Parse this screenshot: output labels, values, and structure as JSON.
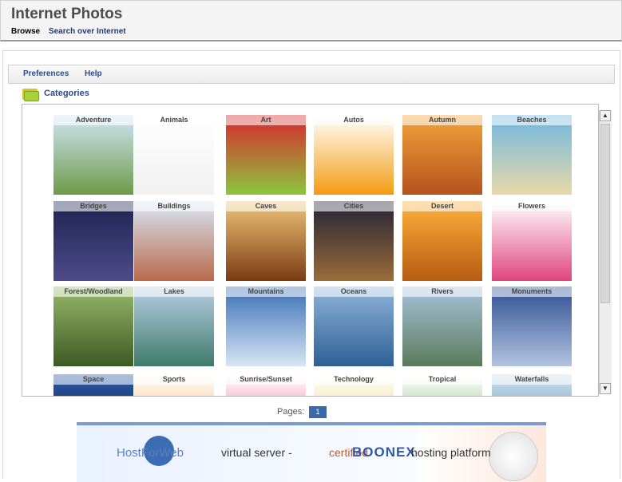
{
  "app": {
    "title": "Internet Photos"
  },
  "nav": {
    "browse": "Browse",
    "search": "Search over Internet"
  },
  "menu": {
    "preferences": "Preferences",
    "help": "Help"
  },
  "categories": {
    "title": "Categories",
    "items": [
      {
        "label": "Adventure",
        "colors": [
          "#cfe6f5",
          "#6e9a4a"
        ]
      },
      {
        "label": "Animals",
        "colors": [
          "#ffffff",
          "#f1f1f1"
        ]
      },
      {
        "label": "Art",
        "colors": [
          "#d9272d",
          "#8cc63e"
        ]
      },
      {
        "label": "Autos",
        "colors": [
          "#ffffff",
          "#f39c12"
        ]
      },
      {
        "label": "Autumn",
        "colors": [
          "#f2a33a",
          "#b5531e"
        ]
      },
      {
        "label": "Beaches",
        "colors": [
          "#6fb7e2",
          "#e8d9a8"
        ]
      },
      {
        "label": "Bridges",
        "colors": [
          "#1b2350",
          "#4e4a8a"
        ]
      },
      {
        "label": "Buildings",
        "colors": [
          "#d7e7f5",
          "#b9694a"
        ]
      },
      {
        "label": "Caves",
        "colors": [
          "#f0c47a",
          "#7a3b12"
        ]
      },
      {
        "label": "Cities",
        "colors": [
          "#222235",
          "#9b6c3a"
        ]
      },
      {
        "label": "Desert",
        "colors": [
          "#ffb13b",
          "#b65c12"
        ]
      },
      {
        "label": "Flowers",
        "colors": [
          "#ffffff",
          "#e0447d"
        ]
      },
      {
        "label": "Forest/Woodland",
        "colors": [
          "#98b86b",
          "#3c5a24"
        ]
      },
      {
        "label": "Lakes",
        "colors": [
          "#b8cfe5",
          "#3f7a6a"
        ]
      },
      {
        "label": "Mountains",
        "colors": [
          "#3a6fb5",
          "#d8e6f5"
        ]
      },
      {
        "label": "Oceans",
        "colors": [
          "#8fb4d9",
          "#2d5f94"
        ]
      },
      {
        "label": "Rivers",
        "colors": [
          "#a8c3dc",
          "#5a7a5a"
        ]
      },
      {
        "label": "Monuments",
        "colors": [
          "#2f4f94",
          "#b2c3de"
        ]
      },
      {
        "label": "Space",
        "colors": [
          "#2a5aa8",
          "#0b1226"
        ]
      },
      {
        "label": "Sports",
        "colors": [
          "#ffffff",
          "#f1a13b"
        ]
      },
      {
        "label": "Sunrise/Sunset",
        "colors": [
          "#ffffff",
          "#e3447a"
        ]
      },
      {
        "label": "Technology",
        "colors": [
          "#ffffff",
          "#e2c64a"
        ]
      },
      {
        "label": "Tropical",
        "colors": [
          "#ffffff",
          "#5aa84a"
        ]
      },
      {
        "label": "Waterfalls",
        "colors": [
          "#cfe2ef",
          "#3f7aa8"
        ]
      }
    ]
  },
  "pagination": {
    "label": "Pages:",
    "current": "1"
  },
  "banner": {
    "brand": "HostForWeb",
    "text1": "virtual server -",
    "text2": "certified",
    "brand2": "BOONEX",
    "text3": "hosting platform"
  }
}
